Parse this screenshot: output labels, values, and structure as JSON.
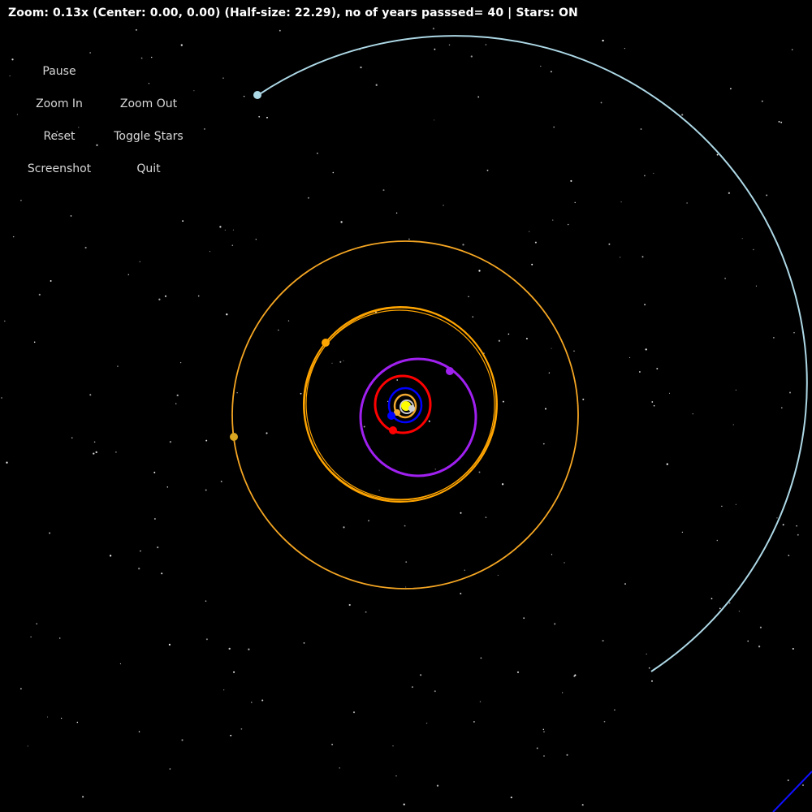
{
  "status": {
    "text": "Zoom: 0.13x (Center: 0.00, 0.00) (Half-size: 22.29), no of years passsed= 40 | Stars: ON"
  },
  "controls": {
    "pause": "Pause",
    "zoom_in": "Zoom In",
    "zoom_out": "Zoom Out",
    "reset": "Reset",
    "toggle_stars": "Toggle Stars",
    "screenshot": "Screenshot",
    "quit": "Quit"
  },
  "colors": {
    "background": "#000000",
    "sun": "#ffff00",
    "mercury": "#bbbbbb",
    "venus": "#f0a830",
    "earth": "#0000ff",
    "mars": "#ff0000",
    "jupiter": "#a020f0",
    "saturn": "#ffa500",
    "uranus": "#daa520",
    "neptune": "#add8e6",
    "stars": "#ffffff"
  },
  "icons": {
    "sun": "sun-icon",
    "planet": "planet-dot-icon"
  }
}
